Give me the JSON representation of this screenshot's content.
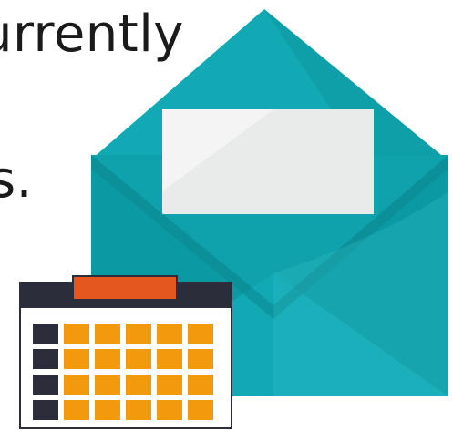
{
  "text": {
    "line1_fragment": "urrently",
    "line2_fragment": "s."
  },
  "colors": {
    "envelope_main": "#10A9B4",
    "envelope_dark": "#0B8B95",
    "envelope_light": "#39C3CC",
    "paper": "#E9EAEA",
    "paper_highlight": "#F6F6F6",
    "calendar_frame": "#2B2D3A",
    "calendar_tab": "#E4571E",
    "calendar_cell": "#F29A0C",
    "calendar_row_marker": "#2B2D3A"
  },
  "icons": [
    "envelope-icon",
    "letter-icon",
    "calendar-icon"
  ]
}
